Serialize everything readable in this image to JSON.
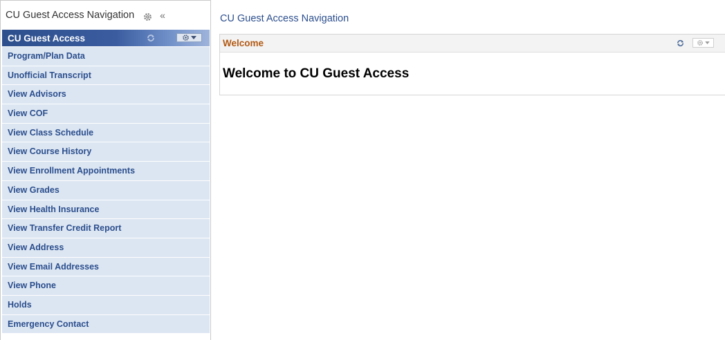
{
  "nav_panel": {
    "title": "CU Guest Access Navigation",
    "pagelet_title": "CU Guest Access",
    "items": [
      {
        "label": "Program/Plan Data"
      },
      {
        "label": "Unofficial Transcript"
      },
      {
        "label": "View Advisors"
      },
      {
        "label": "View COF"
      },
      {
        "label": "View Class Schedule"
      },
      {
        "label": "View Course History"
      },
      {
        "label": "View Enrollment Appointments"
      },
      {
        "label": "View Grades"
      },
      {
        "label": "View Health Insurance"
      },
      {
        "label": "View Transfer Credit Report"
      },
      {
        "label": "View Address"
      },
      {
        "label": "View Email Addresses"
      },
      {
        "label": "View Phone"
      },
      {
        "label": "Holds"
      },
      {
        "label": "Emergency Contact"
      }
    ]
  },
  "main": {
    "title": "CU Guest Access Navigation",
    "welcome_pagelet": {
      "label": "Welcome",
      "heading": "Welcome to CU Guest Access"
    }
  },
  "colors": {
    "nav_link": "#2b4e8d",
    "nav_item_bg": "#dce6f2",
    "pagelet_title_bg": "#2d4f8c",
    "welcome_label": "#b35a14"
  },
  "icons": {
    "settings": "gear-icon",
    "collapse": "double-chevron-left-icon",
    "refresh": "refresh-icon",
    "menu": "gear-dropdown-icon"
  }
}
